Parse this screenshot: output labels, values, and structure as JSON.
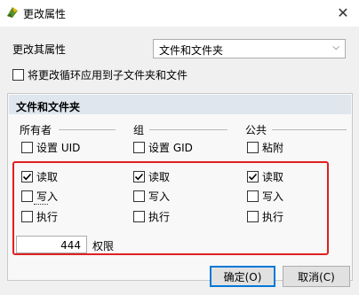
{
  "window": {
    "title": "更改属性",
    "close_glyph": "✕"
  },
  "top": {
    "change_label": "更改其属性",
    "combo_value": "文件和文件夹",
    "combo_arrow": "⌵",
    "recursive_label": "将更改循环应用到子文件夹和文件",
    "recursive_checked": false
  },
  "group": {
    "title": "文件和文件夹",
    "owner": {
      "title": "所有者",
      "special_label": "设置 UID",
      "read_label": "读取",
      "write_label": "写入",
      "exec_label": "执行",
      "read": true,
      "write": false,
      "exec": false,
      "special": false
    },
    "grp": {
      "title": "组",
      "special_label": "设置 GID",
      "read_label": "读取",
      "write_label": "写入",
      "exec_label": "执行",
      "read": true,
      "write": false,
      "exec": false,
      "special": false
    },
    "public": {
      "title": "公共",
      "special_label": "粘附",
      "read_label": "读取",
      "write_label": "写入",
      "exec_label": "执行",
      "read": true,
      "write": false,
      "exec": false,
      "special": false
    },
    "permission_value": "444",
    "permission_label": "权限"
  },
  "buttons": {
    "ok": "确定(O)",
    "cancel": "取消(C)"
  },
  "colors": {
    "highlight": "#e02020",
    "header": "#dfe6ee",
    "default_button_border": "#0078d7"
  }
}
